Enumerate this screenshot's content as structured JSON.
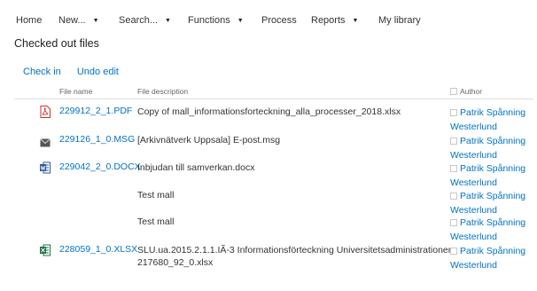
{
  "nav": {
    "home": "Home",
    "new": "New...",
    "search": "Search...",
    "functions": "Functions",
    "process": "Process",
    "reports": "Reports",
    "library": "My library"
  },
  "page_title": "Checked out files",
  "actions": {
    "checkin": "Check in",
    "undo": "Undo edit"
  },
  "table": {
    "headers": {
      "filename": "File name",
      "description": "File description",
      "author": "Author"
    },
    "rows": [
      {
        "icon": "pdf-icon",
        "filename": "229912_2_1.PDF",
        "description": "Copy of mall_informationsforteckning_alla_processer_2018.xlsx",
        "description2": "",
        "author1": "Patrik Spånning",
        "author2": "Westerlund"
      },
      {
        "icon": "mail-icon",
        "filename": "229126_1_0.MSG",
        "description": "[Arkivnätverk Uppsala] E-post.msg",
        "description2": "",
        "author1": "Patrik Spånning",
        "author2": "Westerlund"
      },
      {
        "icon": "word-icon",
        "filename": "229042_2_0.DOCX",
        "description": "Inbjudan till samverkan.docx",
        "description2": "",
        "author1": "Patrik Spånning",
        "author2": "Westerlund"
      },
      {
        "icon": "",
        "filename": "",
        "description": "Test mall",
        "description2": "",
        "author1": "Patrik Spånning",
        "author2": "Westerlund"
      },
      {
        "icon": "",
        "filename": "",
        "description": "Test mall",
        "description2": "",
        "author1": "Patrik Spånning",
        "author2": "Westerlund"
      },
      {
        "icon": "excel-icon",
        "filename": "228059_1_0.XLSX",
        "description": "SLU.ua.2015.2.1.1.IÃ-3 Informationsförteckning Universitetsadministrationen",
        "description2": "217680_92_0.xlsx",
        "author1": "Patrik Spånning",
        "author2": "Westerlund"
      }
    ]
  },
  "colors": {
    "link": "#0072c6",
    "pdf": "#c8332e",
    "word": "#2b579a",
    "excel": "#217346",
    "mail": "#555555"
  }
}
